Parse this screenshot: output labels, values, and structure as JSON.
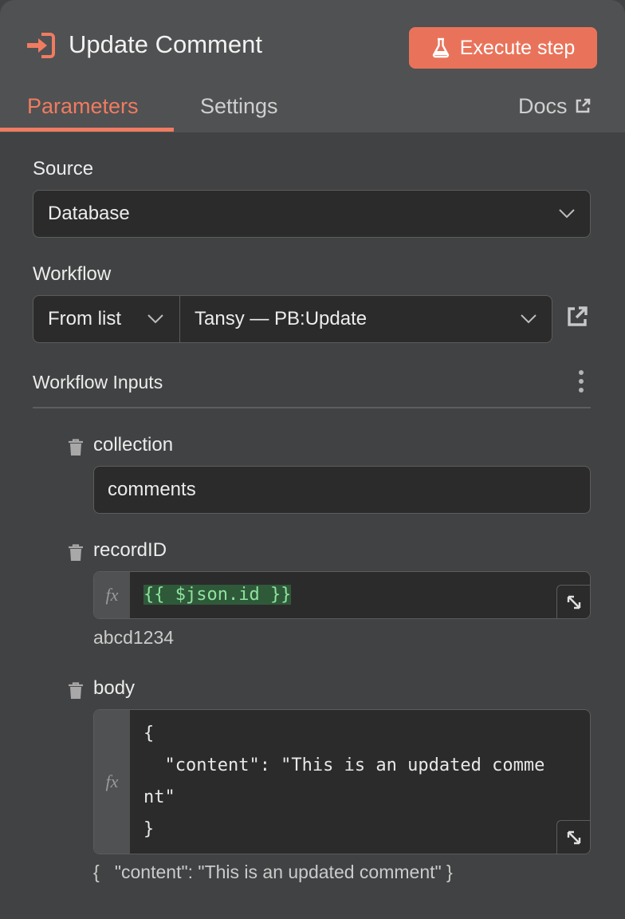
{
  "header": {
    "title": "Update Comment",
    "execute_label": "Execute step"
  },
  "tabs": {
    "parameters": "Parameters",
    "settings": "Settings",
    "docs": "Docs"
  },
  "source": {
    "label": "Source",
    "value": "Database"
  },
  "workflow": {
    "label": "Workflow",
    "mode": "From list",
    "value": "Tansy — PB:Update"
  },
  "inputs": {
    "title": "Workflow Inputs",
    "collection": {
      "label": "collection",
      "value": "comments"
    },
    "record": {
      "label": "recordID",
      "expression": "{{ $json.id }}",
      "result": "abcd1234"
    },
    "body": {
      "label": "body",
      "lines": [
        "{",
        "  \"content\": \"This is an updated comme",
        "nt\"",
        "}"
      ],
      "result": "{   \"content\": \"This is an updated comment\" }"
    },
    "fx_label": "fx"
  },
  "colors": {
    "accent": "#ef7c61",
    "button": "#e9735a",
    "background": "#414243",
    "header": "#505152",
    "field": "#2b2b2b",
    "expression_highlight": "#2f5a3a"
  }
}
